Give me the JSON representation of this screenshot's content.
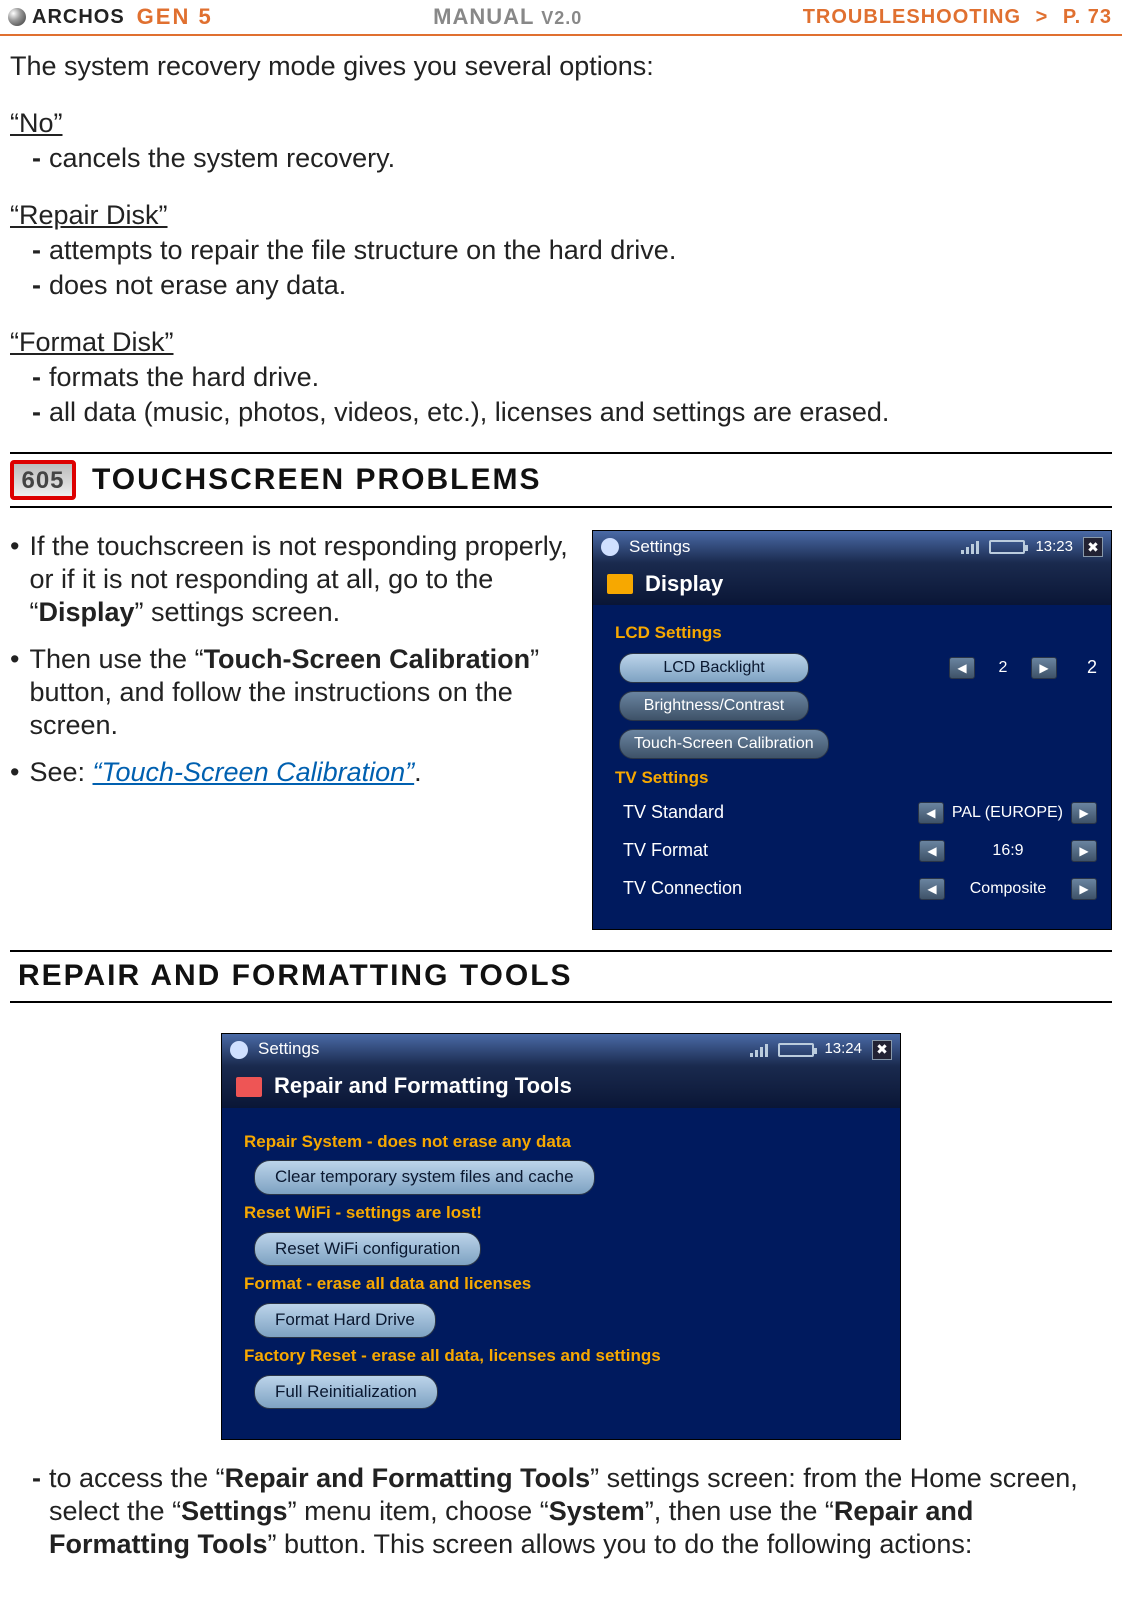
{
  "header": {
    "brand": "ARCHOS",
    "gen": "GEN 5",
    "manual": "MANUAL",
    "version": "V2.0",
    "breadcrumb": "TROUBLESHOOTING",
    "sep": ">",
    "page": "P. 73"
  },
  "intro": "The system recovery mode gives you several options:",
  "options": [
    {
      "title": "“No”",
      "items": [
        "cancels the system recovery."
      ]
    },
    {
      "title": "“Repair Disk”",
      "items": [
        "attempts to repair the file structure on the hard drive.",
        "does not erase any data."
      ]
    },
    {
      "title": "“Format Disk”",
      "items": [
        "formats the hard drive.",
        "all data (music, photos, videos, etc.), licenses and settings are erased."
      ]
    }
  ],
  "section_touch": {
    "badge": "605",
    "title": "TOUCHSCREEN PROBLEMS",
    "text1_a": "If the touchscreen is not responding properly, or if it is not responding at all, go to the “",
    "text1_b": "Display",
    "text1_c": "” settings screen.",
    "text2_a": "Then use the “",
    "text2_b": "Touch-Screen Calibration",
    "text2_c": "” button, and follow the instructions on the screen.",
    "text3_a": "See: ",
    "text3_link": "“Touch-Screen Calibration”",
    "text3_b": "."
  },
  "dev1": {
    "top_label": "Settings",
    "time": "13:23",
    "close": "✖",
    "panel_title": "Display",
    "sec1": "LCD Settings",
    "row_backlight": "LCD Backlight",
    "row_backlight_val": "2",
    "row_bc": "Brightness/Contrast",
    "row_tsc": "Touch-Screen Calibration",
    "sec2": "TV Settings",
    "row_tvstd": "TV Standard",
    "row_tvstd_val": "PAL (EUROPE)",
    "row_tvfmt": "TV Format",
    "row_tvfmt_val": "16:9",
    "row_tvcon": "TV Connection",
    "row_tvcon_val": "Composite"
  },
  "section_repair": {
    "title": "REPAIR AND FORMATTING TOOLS"
  },
  "dev2": {
    "top_label": "Settings",
    "time": "13:24",
    "close": "✖",
    "panel_title": "Repair and Formatting Tools",
    "g1_lbl": "Repair System - does not erase any data",
    "g1_btn": "Clear temporary system files and cache",
    "g2_lbl": "Reset WiFi - settings are lost!",
    "g2_btn": "Reset WiFi configuration",
    "g3_lbl": "Format - erase all data and licenses",
    "g3_btn": "Format Hard Drive",
    "g4_lbl": "Factory Reset - erase all data, licenses and settings",
    "g4_btn": "Full Reinitialization"
  },
  "footer": {
    "a": "to access the “",
    "b1": "Repair and Formatting Tools",
    "c": "” settings screen: from the Home screen, select the “",
    "b2": "Settings",
    "d": "” menu item, choose “",
    "b3": "System",
    "e": "”, then use the “",
    "b4": "Repair and Formatting Tools",
    "f": "” button. This screen allows you to do the following actions:"
  }
}
